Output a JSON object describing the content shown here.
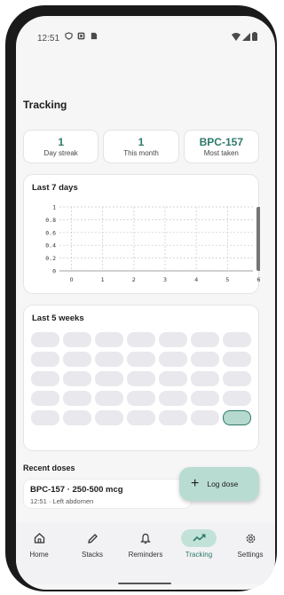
{
  "status_bar": {
    "time": "12:51",
    "left_icons": [
      "shield-icon",
      "square-icon",
      "sim-icon"
    ],
    "right_icons": [
      "wifi-icon",
      "signal-icon",
      "battery-icon"
    ]
  },
  "page": {
    "title": "Tracking"
  },
  "stats": [
    {
      "value": "1",
      "label": "Day streak"
    },
    {
      "value": "1",
      "label": "This month"
    },
    {
      "value": "BPC-157",
      "label": "Most taken"
    }
  ],
  "last7": {
    "title": "Last 7 days",
    "chart_data": {
      "type": "bar",
      "categories": [
        "0",
        "1",
        "2",
        "3",
        "4",
        "5",
        "6"
      ],
      "values": [
        0,
        0,
        0,
        0,
        0,
        0,
        1
      ],
      "y_ticks": [
        "0",
        "0.2",
        "0.4",
        "0.6",
        "0.8",
        "1"
      ],
      "ylim": [
        0,
        1
      ],
      "grid": true,
      "bar_color": "#757575"
    }
  },
  "last5": {
    "title": "Last 5 weeks",
    "rows": 5,
    "cols": 7,
    "active_cells": [
      [
        4,
        6
      ]
    ]
  },
  "recent": {
    "title": "Recent doses",
    "items": [
      {
        "name": "BPC-157 · 250-500 mcg",
        "detail": "12:51 · Left abdomen"
      }
    ]
  },
  "fab": {
    "label": "Log dose",
    "icon": "plus-icon"
  },
  "nav": {
    "items": [
      {
        "label": "Home",
        "icon": "home-icon"
      },
      {
        "label": "Stacks",
        "icon": "pencil-icon"
      },
      {
        "label": "Reminders",
        "icon": "bell-icon"
      },
      {
        "label": "Tracking",
        "icon": "trending-icon",
        "selected": true
      },
      {
        "label": "Settings",
        "icon": "gear-icon"
      }
    ]
  },
  "colors": {
    "accent": "#2e7a6b",
    "accent_light": "#c2e2d8",
    "cell": "#e8e8ed"
  }
}
